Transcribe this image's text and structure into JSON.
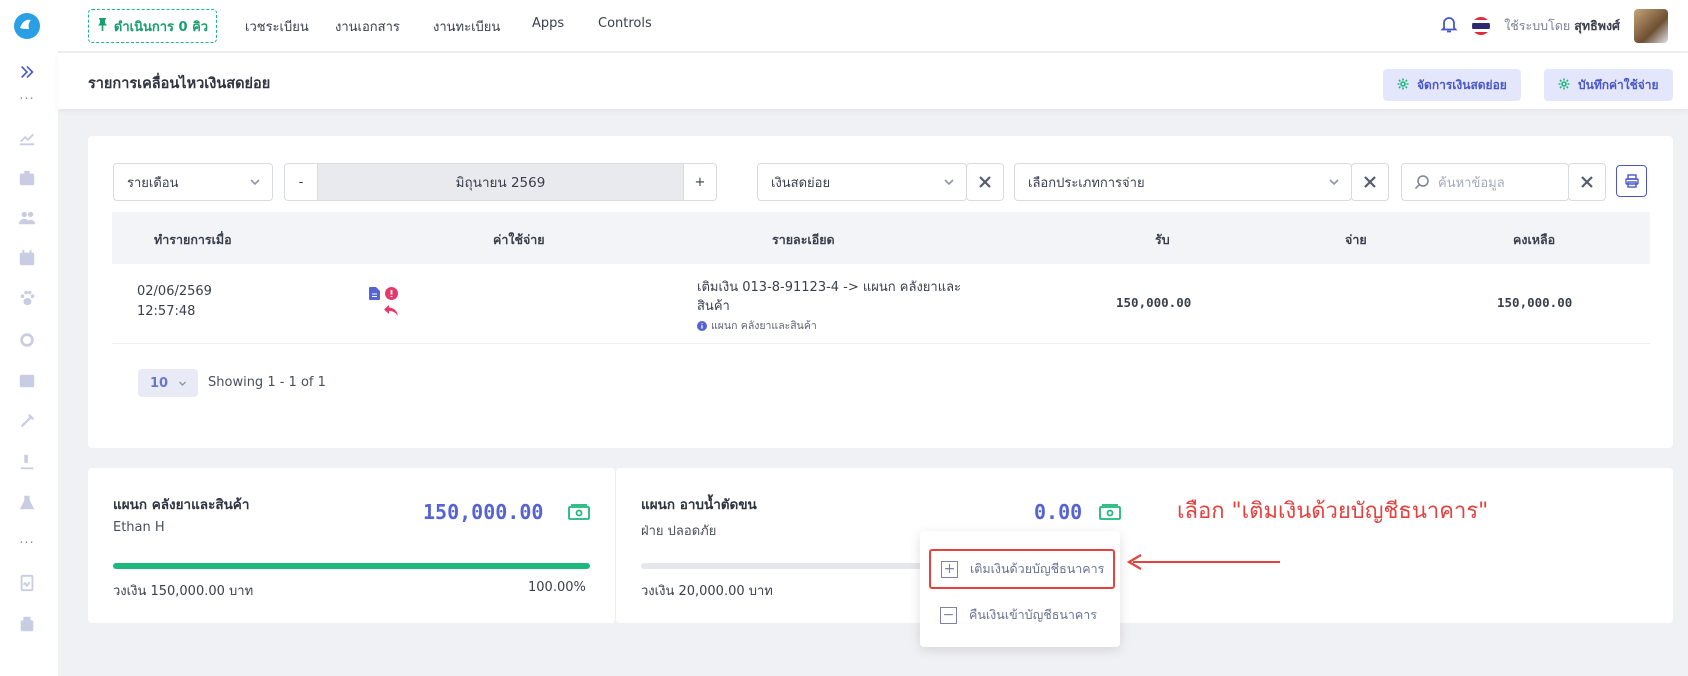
{
  "topbar": {
    "queue_label": "ดำเนินการ 0 คิว",
    "nav": [
      "เวชระเบียน",
      "งานเอกสาร",
      "งานทะเบียน",
      "Apps",
      "Controls"
    ],
    "user_prefix": "ใช้ระบบโดย",
    "user_name": "สุทธิพงศ์"
  },
  "page": {
    "title": "รายการเคลื่อนไหวเงินสดย่อย",
    "btn_manage": "จัดการเงินสดย่อย",
    "btn_record": "บันทึกค่าใช้จ่าย"
  },
  "filters": {
    "period": "รายเดือน",
    "minus": "-",
    "month": "มิถุนายน 2569",
    "plus": "+",
    "fund": "เงินสดย่อย",
    "expense_type_placeholder": "เลือกประเภทการจ่าย",
    "search_placeholder": "ค้นหาข้อมูล"
  },
  "table": {
    "headers": [
      "ทำรายการเมื่อ",
      "ค่าใช้จ่าย",
      "รายละเอียด",
      "รับ",
      "จ่าย",
      "คงเหลือ"
    ],
    "rows": [
      {
        "date": "02/06/2569",
        "time": "12:57:48",
        "detail_line1": "เติมเงิน 013-8-91123-4 -> แผนก คลังยาและ",
        "detail_line2": "สินค้า",
        "detail_note": "แผนก คลังยาและสินค้า",
        "receive": "150,000.00",
        "pay": "",
        "balance": "150,000.00"
      }
    ],
    "page_size": "10",
    "showing": "Showing 1 - 1 of 1"
  },
  "accounts": [
    {
      "name": "แผนก คลังยาและสินค้า",
      "owner": "Ethan H",
      "amount": "150,000.00",
      "limit": "วงเงิน 150,000.00 บาท",
      "percent": "100.00%",
      "fill_ratio": 1.0
    },
    {
      "name": "แผนก อาบน้ำตัดขน",
      "owner": "ฝ่าย ปลอดภัย",
      "amount": "0.00",
      "limit": "วงเงิน 20,000.00 บาท",
      "fill_ratio": 0.0
    }
  ],
  "dropdown": {
    "topup": "เติมเงินด้วยบัญชีธนาคาร",
    "refund": "คืนเงินเข้าบัญชีธนาคาร"
  },
  "annotation": "เลือก \"เติมเงินด้วยบัญชีธนาคาร\"",
  "colors": {
    "accent": "#5563d3",
    "success": "#1db87c",
    "annotation": "#e3423f"
  }
}
